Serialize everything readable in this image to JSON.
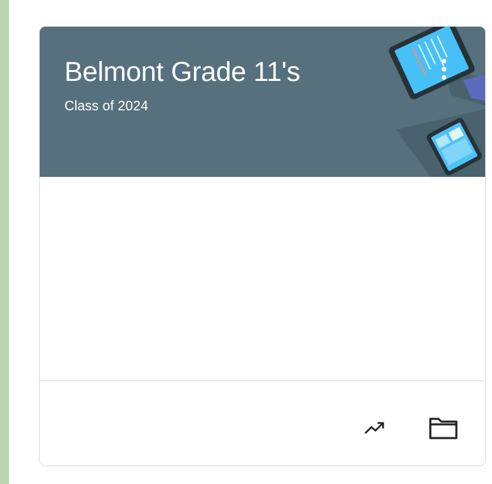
{
  "class_card": {
    "title": "Belmont Grade 11's",
    "section": "Class of 2024",
    "header_color": "#56707d",
    "menu_icon": "more-vert-icon",
    "actions": [
      {
        "icon": "trending-up-icon"
      },
      {
        "icon": "folder-icon"
      }
    ]
  }
}
